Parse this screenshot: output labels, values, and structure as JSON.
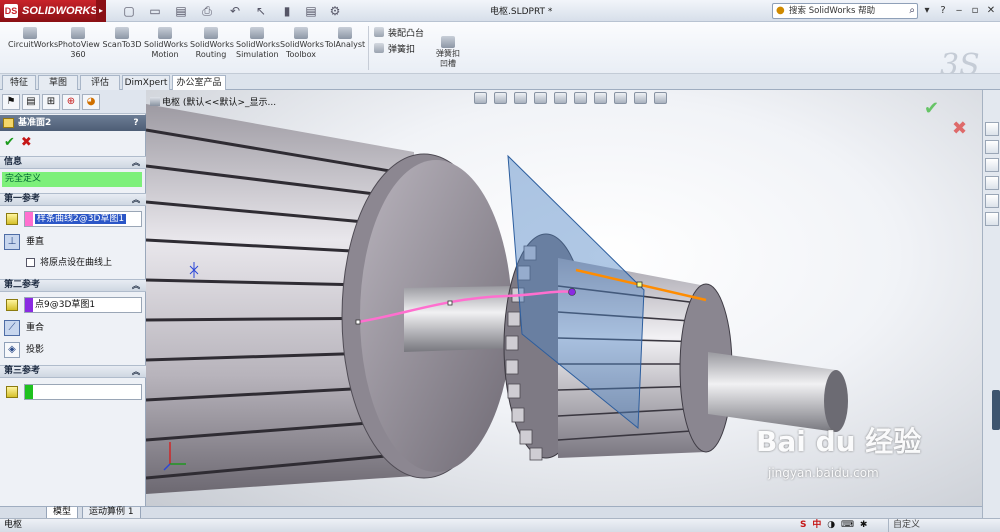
{
  "app": {
    "brand": "SOLIDWORKS",
    "brand_mark": "3S",
    "document_title": "电枢.SLDPRT *",
    "help_search_placeholder": "搜索 SolidWorks 帮助"
  },
  "command_manager": {
    "addins": [
      {
        "line1": "CircuitWorks",
        "line2": ""
      },
      {
        "line1": "PhotoView",
        "line2": "360"
      },
      {
        "line1": "ScanTo3D",
        "line2": ""
      },
      {
        "line1": "SolidWorks",
        "line2": "Motion"
      },
      {
        "line1": "SolidWorks",
        "line2": "Routing"
      },
      {
        "line1": "SolidWorks",
        "line2": "Simulation"
      },
      {
        "line1": "SolidWorks",
        "line2": "Toolbox"
      },
      {
        "line1": "TolAnalyst",
        "line2": ""
      }
    ],
    "assembly_boss": "装配凸台",
    "snap_hook": "弹簧扣",
    "snap_hook_groove_line1": "弹簧扣",
    "snap_hook_groove_line2": "凹槽"
  },
  "tabs": [
    "特征",
    "草图",
    "评估",
    "DimXpert",
    "办公室产品"
  ],
  "active_tab": 4,
  "property_manager": {
    "title": "基准面2",
    "help": "?",
    "messages_header": "信息",
    "status": "完全定义",
    "first_ref_header": "第一参考",
    "first_ref_value": "样条曲线2@3D草图1",
    "first_ref_option": "垂直",
    "first_ref_checkbox": "将原点设在曲线上",
    "second_ref_header": "第二参考",
    "second_ref_value": "点9@3D草图1",
    "second_ref_option1": "重合",
    "second_ref_option2": "投影",
    "third_ref_header": "第三参考",
    "third_ref_value": "",
    "colors": {
      "first_ref": "#ff6fcf",
      "second_ref": "#8a2be2",
      "third_ref": "#1fc11f"
    }
  },
  "viewport": {
    "tree_root": "电枢 (默认<<默认>_显示...",
    "watermark": "Bai du 经验",
    "watermark_url": "jingyan.baidu.com"
  },
  "bottom_tabs": [
    "模型",
    "运动算例 1"
  ],
  "status": {
    "left": "电枢",
    "ime": "中",
    "right": "自定义"
  }
}
